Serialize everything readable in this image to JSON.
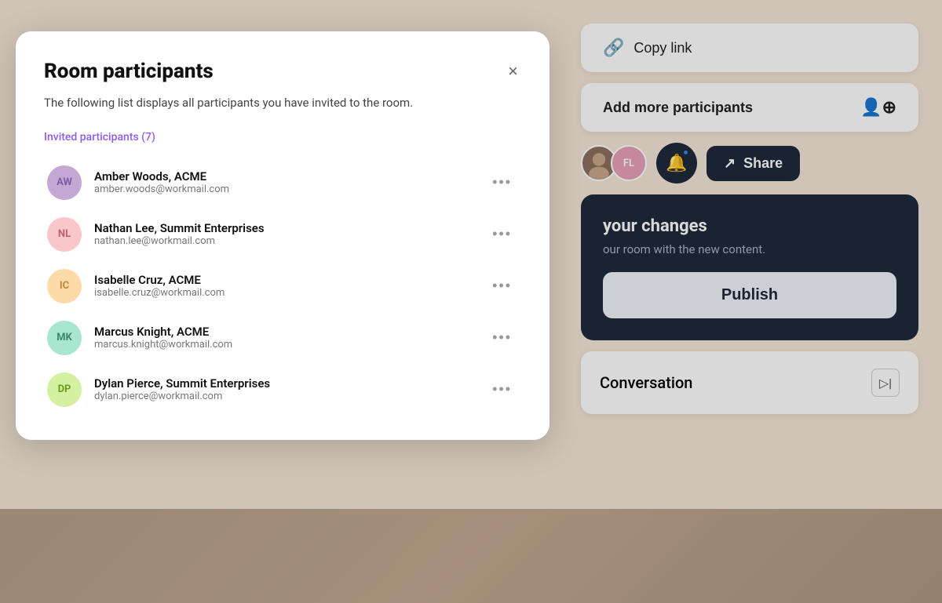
{
  "background_color": "#f5e6d8",
  "modal": {
    "title": "Room participants",
    "description": "The following list displays all participants you have invited\nto the room.",
    "close_label": "×",
    "invited_label": "Invited participants (7)",
    "participants": [
      {
        "initials": "AW",
        "name": "Amber Woods, ACME",
        "email": "amber.woods@workmail.com",
        "avatar_color": "#C4A8D4",
        "text_color": "#7B5EA7"
      },
      {
        "initials": "NL",
        "name": "Nathan Lee, Summit Enterprises",
        "email": "nathan.lee@workmail.com",
        "avatar_color": "#F9C6C9",
        "text_color": "#C06070"
      },
      {
        "initials": "IC",
        "name": "Isabelle Cruz, ACME",
        "email": "isabelle.cruz@workmail.com",
        "avatar_color": "#FDDBA8",
        "text_color": "#C0853A"
      },
      {
        "initials": "MK",
        "name": "Marcus Knight, ACME",
        "email": "marcus.knight@workmail.com",
        "avatar_color": "#A8E6CF",
        "text_color": "#3A8A6A"
      },
      {
        "initials": "DP",
        "name": "Dylan Pierce, Summit Enterprises",
        "email": "dylan.pierce@workmail.com",
        "avatar_color": "#D4F0A0",
        "text_color": "#6A9A20"
      }
    ],
    "more_dots": "•••"
  },
  "right_panel": {
    "copy_link_label": "Copy link",
    "copy_link_icon": "🔗",
    "add_participants_label": "Add more participants",
    "notification_label": "Notifications",
    "share_label": "Share",
    "share_icon": "↗",
    "avatars": [
      {
        "type": "image",
        "bg": "#8B6F5E"
      },
      {
        "initials": "FL",
        "bg": "#E8A0B8"
      }
    ],
    "publish_card": {
      "title": "your changes",
      "subtitle": "our room with the new content.",
      "publish_button_label": "Publish"
    },
    "conversation_label": "Conversation"
  }
}
